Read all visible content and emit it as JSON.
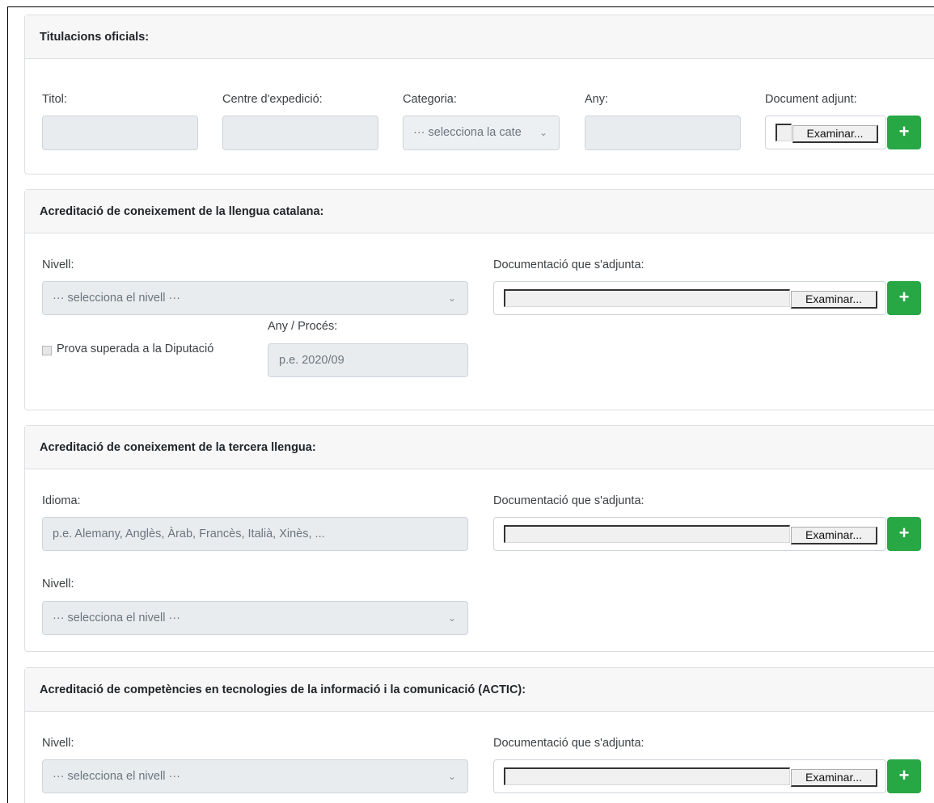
{
  "titulacions": {
    "header": "Titulacions oficials:",
    "titol_label": "Titol:",
    "centre_label": "Centre d'expedició:",
    "categoria_label": "Categoria:",
    "categoria_value": "··· selecciona la cate",
    "any_label": "Any:",
    "document_label": "Document adjunt:",
    "browse_label": "Examinar...",
    "add_label": "+"
  },
  "catalana": {
    "header": "Acreditació de coneixement de la llengua catalana:",
    "nivell_label": "Nivell:",
    "nivell_value": "··· selecciona el nivell ···",
    "doc_label": "Documentació que s'adjunta:",
    "browse_label": "Examinar...",
    "add_label": "+",
    "prova_label": "Prova superada a la Diputació",
    "any_proces_label": "Any / Procés:",
    "any_proces_placeholder": "p.e. 2020/09"
  },
  "tercera": {
    "header": "Acreditació de coneixement de la tercera llengua:",
    "idioma_label": "Idioma:",
    "idioma_placeholder": "p.e. Alemany, Anglès, Àrab, Francès, Italià, Xinès, ...",
    "doc_label": "Documentació que s'adjunta:",
    "browse_label": "Examinar...",
    "add_label": "+",
    "nivell_label": "Nivell:",
    "nivell_value": "··· selecciona el nivell ···"
  },
  "actic": {
    "header": "Acreditació de competències en tecnologies de la informació i la comunicació (ACTIC):",
    "nivell_label": "Nivell:",
    "nivell_value": "··· selecciona el nivell ···",
    "doc_label": "Documentació que s'adjunta:",
    "browse_label": "Examinar...",
    "add_label": "+"
  },
  "icons": {
    "chevron": "chevron-down-icon",
    "add": "plus-icon"
  },
  "colors": {
    "add_button": "#28a745",
    "input_disabled": "#e9ecef",
    "header_bg": "#f7f7f7"
  }
}
